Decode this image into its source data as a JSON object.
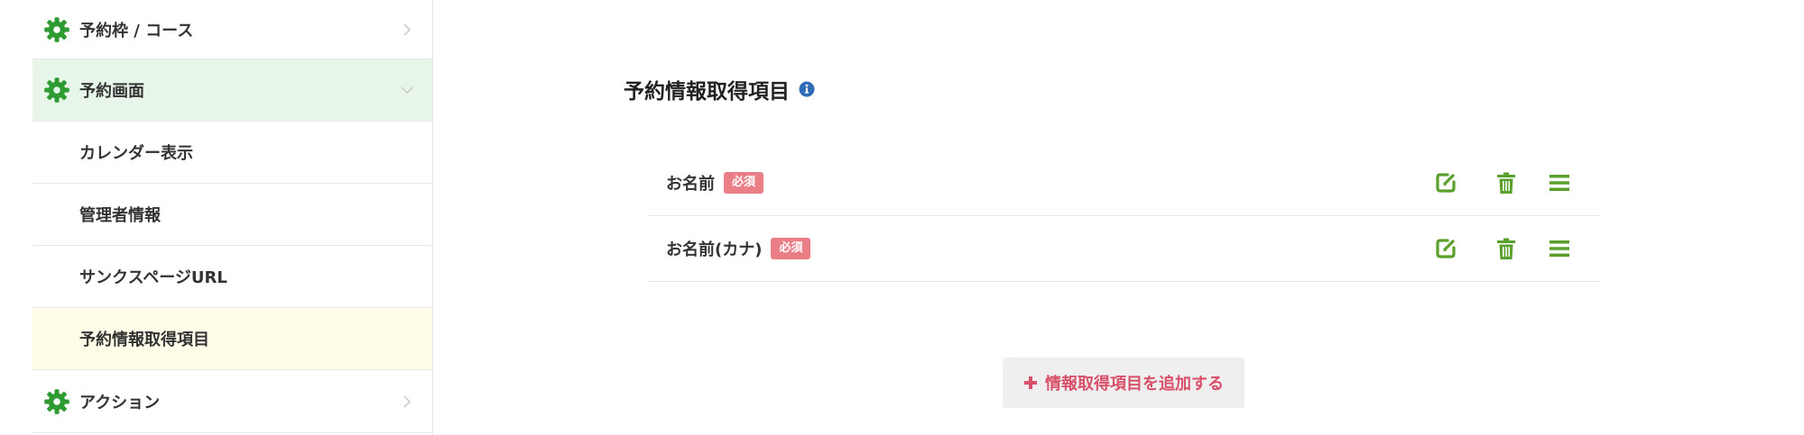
{
  "colors": {
    "accent_green": "#5aa02c",
    "gear_green": "#2e9a32",
    "badge_red": "#ea7e86",
    "add_button_text": "#d9506a",
    "info_blue": "#2f6cb5",
    "expanded_bg": "#e8f5e9",
    "active_bg": "#fffde8"
  },
  "sidebar": {
    "items": [
      {
        "label": "予約枠 / コース",
        "icon": "gear-icon",
        "chevron": "chevron-right-icon"
      },
      {
        "label": "予約画面",
        "icon": "gear-icon",
        "chevron": "chevron-down-icon"
      },
      {
        "label": "カレンダー表示"
      },
      {
        "label": "管理者情報"
      },
      {
        "label": "サンクスページURL"
      },
      {
        "label": "予約情報取得項目"
      },
      {
        "label": "アクション",
        "icon": "gear-icon",
        "chevron": "chevron-right-icon"
      }
    ]
  },
  "main": {
    "title": "予約情報取得項目",
    "title_icon": "info-icon",
    "fields": [
      {
        "label": "お名前",
        "badge": "必須"
      },
      {
        "label": "お名前(カナ)",
        "badge": "必須"
      }
    ],
    "row_icons": [
      "edit-icon",
      "trash-icon",
      "menu-icon"
    ],
    "add_button_label": "情報取得項目を追加する"
  }
}
